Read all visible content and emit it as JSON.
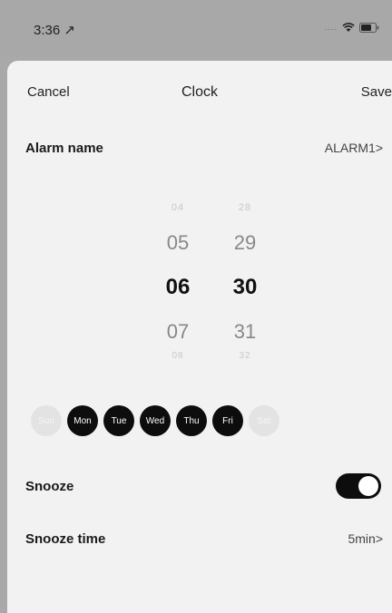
{
  "status_bar": {
    "time": "3:36 ↗",
    "signal": "....",
    "wifi_icon": "wifi-icon",
    "battery_icon": "battery-icon"
  },
  "nav": {
    "cancel": "Cancel",
    "title": "Clock",
    "save": "Save"
  },
  "alarm_name": {
    "label": "Alarm name",
    "value": "ALARM1>"
  },
  "picker": {
    "hours": [
      "04",
      "05",
      "06",
      "07",
      "08"
    ],
    "minutes": [
      "28",
      "29",
      "30",
      "31",
      "32"
    ],
    "selected_hour": "06",
    "selected_minute": "30"
  },
  "days": [
    {
      "label": "Sun",
      "selected": false
    },
    {
      "label": "Mon",
      "selected": true
    },
    {
      "label": "Tue",
      "selected": true
    },
    {
      "label": "Wed",
      "selected": true
    },
    {
      "label": "Thu",
      "selected": true
    },
    {
      "label": "Fri",
      "selected": true
    },
    {
      "label": "Sat",
      "selected": false
    }
  ],
  "snooze": {
    "label": "Snooze",
    "enabled": true
  },
  "snooze_time": {
    "label": "Snooze time",
    "value": "5min>"
  },
  "colors": {
    "accent": "#0d0d0d",
    "sheet_bg": "#f2f2f2",
    "backdrop": "#a9a9a9"
  }
}
